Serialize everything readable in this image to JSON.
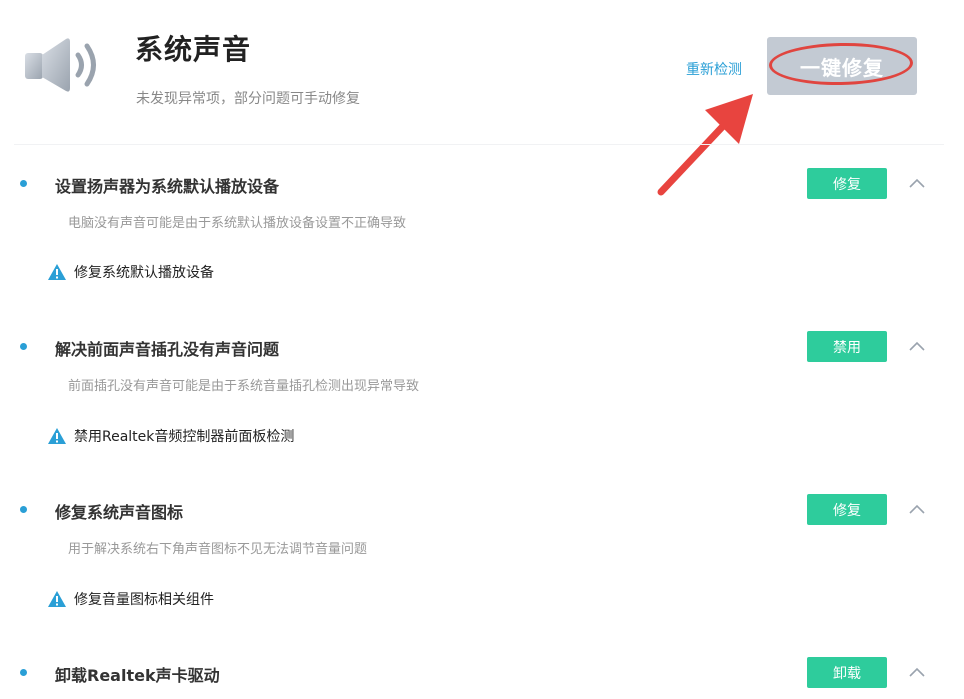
{
  "header": {
    "title": "系统声音",
    "subtitle": "未发现异常项，部分问题可手动修复",
    "recheck_label": "重新检测",
    "fix_all_label": "一键修复"
  },
  "colors": {
    "accent_blue": "#2a9fd6",
    "action_green": "#2ecc9c",
    "annotation_red": "#e0453f",
    "disabled_gray": "#c3cad3"
  },
  "sections": [
    {
      "title": "设置扬声器为系统默认播放设备",
      "description": "电脑没有声音可能是由于系统默认播放设备设置不正确导致",
      "fix_item": "修复系统默认播放设备",
      "action_label": "修复"
    },
    {
      "title": "解决前面声音插孔没有声音问题",
      "description": "前面插孔没有声音可能是由于系统音量插孔检测出现异常导致",
      "fix_item": "禁用Realtek音频控制器前面板检测",
      "action_label": "禁用"
    },
    {
      "title": "修复系统声音图标",
      "description": "用于解决系统右下角声音图标不见无法调节音量问题",
      "fix_item": "修复音量图标相关组件",
      "action_label": "修复"
    },
    {
      "title": "卸载Realtek声卡驱动",
      "action_label": "卸载"
    }
  ]
}
